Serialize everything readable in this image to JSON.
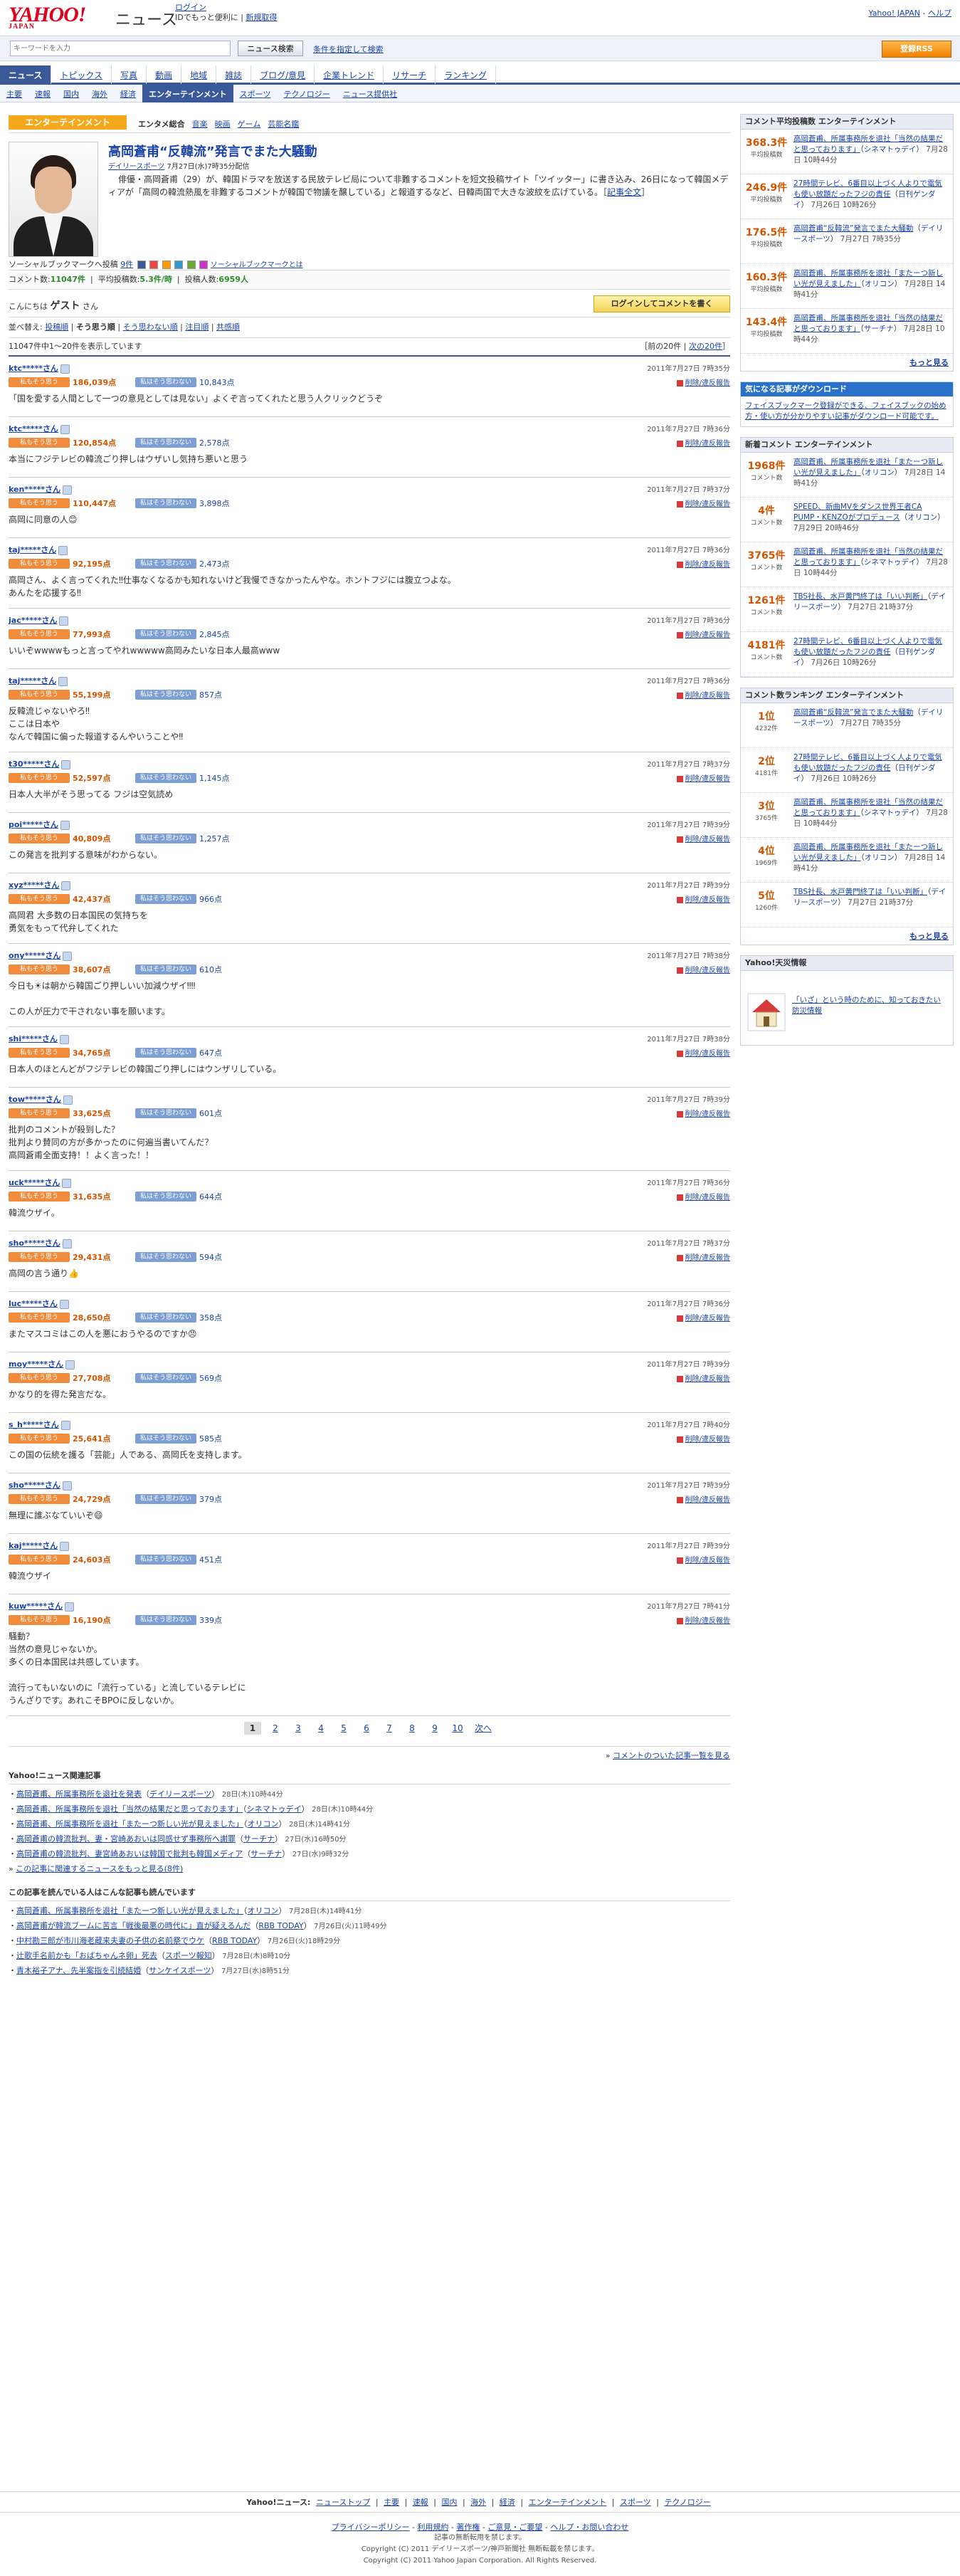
{
  "header": {
    "logo": "YAHOO!",
    "logo_sub": "JAPAN",
    "site_name": "ニュース",
    "login_link": "ログイン",
    "login_note": "IDでもっと便利に",
    "register_link": "新規取得",
    "top_links": [
      "Yahoo! JAPAN",
      "ヘルプ"
    ],
    "search_placeholder": "キーワードを入力",
    "search_button": "ニュース検索",
    "search_condition": "条件を指定して検索",
    "register_button": "登録RSS"
  },
  "global_nav": [
    "ニュース",
    "トピックス",
    "写真",
    "動画",
    "地域",
    "雑誌",
    "ブログ/意見",
    "企業トレンド",
    "リサーチ",
    "ランキング"
  ],
  "sub_nav": [
    "主要",
    "速報",
    "国内",
    "海外",
    "経済",
    "エンターテインメント",
    "スポーツ",
    "テクノロジー",
    "ニュース提供社"
  ],
  "category": {
    "label": "エンターテインメント",
    "tabs": [
      "エンタメ総合",
      "音楽",
      "映画",
      "ゲーム",
      "芸能名鑑"
    ]
  },
  "article": {
    "title": "高岡蒼甫“反韓流”発言でまた大騒動",
    "source": "デイリースポーツ",
    "date": "7月27日(水)7時35分配信",
    "body": "俳優・高岡蒼甫（29）が、韓国ドラマを放送する民放テレビ局について非難するコメントを短文投稿サイト「ツイッター」に書き込み、26日になって韓国メディアが「高岡の韓流熱風を非難するコメントが韓国で物議を醸している」と報道するなど、日韓両国で大きな波紋を広げている。",
    "full_link": "記事全文",
    "social_label": "ソーシャルブックマークへ投稿",
    "social_count": "9件",
    "social_note": "ソーシャルブックマークとは"
  },
  "stats": {
    "comment_count_label": "コメント数:",
    "comment_count": "11047件",
    "avg_label": "平均投稿数:",
    "avg": "5.3件/時",
    "posters_label": "投稿人数:",
    "posters": "6959人"
  },
  "guest": {
    "hello": "こんにちは",
    "name": "ゲスト",
    "suffix": "さん",
    "login_button": "ログインしてコメントを書く"
  },
  "sort": {
    "label": "並べ替え:",
    "options": [
      "投稿順",
      "そう思う順",
      "そう思わない順",
      "注目順",
      "共感順"
    ],
    "active": 1
  },
  "count_text": "11047件中1～20件を表示しています",
  "pager_top": [
    "前の20件",
    "次の20件"
  ],
  "vote_labels": {
    "agree": "私もそう思う",
    "disagree": "私はそう思わない",
    "report": "削除/違反報告",
    "unit": "点"
  },
  "comments": [
    {
      "user": "ktc*****さん",
      "date": "2011年7月27日 7時35分",
      "agree": "186,039",
      "disagree": "10,843",
      "lines": [
        "「国を愛する人間として一つの意見としては見ない」よくぞ言ってくれたと思う人クリックどうぞ"
      ]
    },
    {
      "user": "ktc*****さん",
      "date": "2011年7月27日 7時36分",
      "agree": "120,854",
      "disagree": "2,578",
      "lines": [
        "本当にフジテレビの韓流ごり押しはウザいし気持ち悪いと思う"
      ]
    },
    {
      "user": "ken*****さん",
      "date": "2011年7月27日 7時37分",
      "agree": "110,447",
      "disagree": "3,898",
      "lines": [
        "高岡に同意の人😊"
      ]
    },
    {
      "user": "taj*****さん",
      "date": "2011年7月27日 7時36分",
      "agree": "92,195",
      "disagree": "2,473",
      "lines": [
        "高岡さん、よく言ってくれた‼仕事なくなるかも知れないけど我慢できなかったんやな。ホントフジには腹立つよな。",
        "あんたを応援する‼"
      ]
    },
    {
      "user": "jac*****さん",
      "date": "2011年7月27日 7時36分",
      "agree": "77,993",
      "disagree": "2,845",
      "lines": [
        "いいぞwwwwもっと言ってやれwwwww高岡みたいな日本人最高www"
      ]
    },
    {
      "user": "taj*****さん",
      "date": "2011年7月27日 7時36分",
      "agree": "55,199",
      "disagree": "857",
      "lines": [
        "反韓流じゃないやろ‼",
        "ここは日本や",
        "なんで韓国に偏った報道するんやいうことや‼"
      ]
    },
    {
      "user": "t30*****さん",
      "date": "2011年7月27日 7時37分",
      "agree": "52,597",
      "disagree": "1,145",
      "lines": [
        "日本人大半がそう思ってる フジは空気読め"
      ]
    },
    {
      "user": "poi*****さん",
      "date": "2011年7月27日 7時39分",
      "agree": "40,809",
      "disagree": "1,257",
      "lines": [
        "この発言を批判する意味がわからない。"
      ]
    },
    {
      "user": "xyz*****さん",
      "date": "2011年7月27日 7時39分",
      "agree": "42,437",
      "disagree": "966",
      "lines": [
        "高岡君 大多数の日本国民の気持ちを",
        "勇気をもって代弁してくれた"
      ]
    },
    {
      "user": "ony*****さん",
      "date": "2011年7月27日 7時38分",
      "agree": "38,607",
      "disagree": "610",
      "lines": [
        "今日も☀は朝から韓国ごり押しいい加減ウザイ‼‼",
        "",
        "この人が圧力で干されない事を願います。"
      ]
    },
    {
      "user": "shi*****さん",
      "date": "2011年7月27日 7時38分",
      "agree": "34,765",
      "disagree": "647",
      "lines": [
        "日本人のほとんどがフジテレビの韓国ごり押しにはウンザリしている。"
      ]
    },
    {
      "user": "tow*****さん",
      "date": "2011年7月27日 7時39分",
      "agree": "33,625",
      "disagree": "601",
      "lines": [
        "批判のコメントが殺到した？",
        "批判より賛同の方が多かったのに何遍当書いてんだ？",
        "高岡蒼甫全面支持！！よく言った！！"
      ]
    },
    {
      "user": "uck*****さん",
      "date": "2011年7月27日 7時36分",
      "agree": "31,635",
      "disagree": "644",
      "lines": [
        "韓流ウザイ。"
      ]
    },
    {
      "user": "sho*****さん",
      "date": "2011年7月27日 7時37分",
      "agree": "29,431",
      "disagree": "594",
      "lines": [
        "高岡の言う通り👍"
      ]
    },
    {
      "user": "luc*****さん",
      "date": "2011年7月27日 7時36分",
      "agree": "28,650",
      "disagree": "358",
      "lines": [
        "またマスコミはこの人を悪におうやるのですか😠"
      ]
    },
    {
      "user": "moy*****さん",
      "date": "2011年7月27日 7時39分",
      "agree": "27,708",
      "disagree": "569",
      "lines": [
        "かなり的を得た発言だな。"
      ]
    },
    {
      "user": "s_h*****さん",
      "date": "2011年7月27日 7時40分",
      "agree": "25,641",
      "disagree": "585",
      "lines": [
        "この国の伝統を護る「芸能」人である、高岡氏を支持します。"
      ]
    },
    {
      "user": "sho*****さん",
      "date": "2011年7月27日 7時39分",
      "agree": "24,729",
      "disagree": "379",
      "lines": [
        "無理に誰ぶなていいぞ😄"
      ]
    },
    {
      "user": "kaj*****さん",
      "date": "2011年7月27日 7時39分",
      "agree": "24,603",
      "disagree": "451",
      "lines": [
        "韓流ウザイ"
      ]
    },
    {
      "user": "kuw*****さん",
      "date": "2011年7月27日 7時41分",
      "agree": "16,190",
      "disagree": "339",
      "lines": [
        "騒動？",
        "当然の意見じゃないか。",
        "多くの日本国民は共感しています。",
        "",
        "流行ってもいないのに「流行っている」と流しているテレビに",
        "うんざりです。あれこそBPOに反しないか。"
      ]
    }
  ],
  "pager": [
    "1",
    "2",
    "3",
    "4",
    "5",
    "6",
    "7",
    "8",
    "9",
    "10",
    "次へ"
  ],
  "all_comments_link": "コメントのついた記事一覧を見る",
  "related": {
    "heading": "Yahoo!ニュース関連記事",
    "items": [
      {
        "title": "高岡蒼甫、所属事務所を退社を発表",
        "src": "デイリースポーツ",
        "date": "28日(木)10時44分"
      },
      {
        "title": "高岡蒼甫、所属事務所を退社「当然の結果だと思っております」",
        "src": "シネマトゥデイ",
        "date": "28日(木)10時44分"
      },
      {
        "title": "高岡蒼甫、所属事務所を退社「またーつ新しい光が見えました」",
        "src": "オリコン",
        "date": "28日(木)14時41分"
      },
      {
        "title": "高岡蒼甫の韓流批判、妻・宮崎あおいは同感せず事務所へ謝罪",
        "src": "サーチナ",
        "date": "27日(水)16時50分"
      },
      {
        "title": "高岡蒼甫の韓流批判、妻宮崎あおいは韓国で批判も韓国メディア",
        "src": "サーチナ",
        "date": "27日(水)9時32分"
      }
    ],
    "more": "この記事に関連するニュースをもっと見る(8件)"
  },
  "also_read": {
    "heading": "この記事を読んでいる人はこんな記事も読んでいます",
    "items": [
      {
        "title": "高岡蒼甫、所属事務所を退社「またーつ新しい光が見えました」",
        "src": "オリコン",
        "date": "7月28日(木)14時41分"
      },
      {
        "title": "高岡蒼甫が韓流ブームに苦言「戦後最悪の時代に」直が疑えるんだ",
        "src": "RBB TODAY",
        "date": "7月26日(火)11時49分"
      },
      {
        "title": "中村勘三郎が市川海老蔵来夫妻の子供の名前祭でウケ",
        "src": "RBB TODAY",
        "date": "7月26日(火)18時29分"
      },
      {
        "title": "辻歌手名前かも「おばちゃんネ卵」死去",
        "src": "スポーツ報知",
        "date": "7月28日(木)8時10分"
      },
      {
        "title": "青木裕子アナ、先半案指を引続結婚",
        "src": "サンケイスポーツ",
        "date": "7月27日(水)8時51分"
      }
    ]
  },
  "footer": {
    "nav_label": "Yahoo!ニュース:",
    "nav": [
      "ニューストップ",
      "主要",
      "速報",
      "国内",
      "海外",
      "経済",
      "エンターテインメント",
      "スポーツ",
      "テクノロジー"
    ],
    "policy": [
      "プライバシーポリシー",
      "利用規約",
      "著作権",
      "ご意見・ご要望",
      "ヘルプ・お問い合わせ"
    ],
    "copy1": "記事の無断転用を禁じます。",
    "copy2": "Copyright (C) 2011 デイリースポーツ/神戸新聞社 無断転載を禁じます。",
    "copy3": "Copyright (C) 2011 Yahoo Japan Corporation. All Rights Reserved."
  },
  "side": {
    "ranking1": {
      "heading": "コメント平均投稿数",
      "category": "エンターテインメント",
      "unit": "平均投稿数",
      "items": [
        {
          "num": "368.3件",
          "title": "高岡蒼甫、所属事務所を退社「当然の結果だと思っております」",
          "src": "シネマトゥデイ",
          "date": "7月28日 10時44分"
        },
        {
          "num": "246.9件",
          "title": "27時間テレビ、6番目以上づく人よりで電気も使い放題だったフジの責任",
          "src": "日刊ゲンダイ",
          "date": "7月26日 10時26分"
        },
        {
          "num": "176.5件",
          "title": "高岡蒼甫“反韓流”発言でまた大騒動",
          "src": "デイリースポーツ",
          "date": "7月27日 7時35分"
        },
        {
          "num": "160.3件",
          "title": "高岡蒼甫、所属事務所を退社「またーつ新しい光が見えました」",
          "src": "オリコン",
          "date": "7月28日 14時41分"
        },
        {
          "num": "143.4件",
          "title": "高岡蒼甫、所属事務所を退社「当然の結果だと思っております」",
          "src": "サーチナ",
          "date": "7月28日 10時44分"
        }
      ],
      "more": "もっと見る"
    },
    "banner": {
      "heading": "気になる記事がダウンロード",
      "body": "フェイスブックマーク登録ができる、フェイスブックの始め方・使い方が分かりやすい記事がダウンロード可能です。"
    },
    "ranking2": {
      "heading": "新着コメント",
      "category": "エンターテインメント",
      "unit": "コメント数",
      "items": [
        {
          "num": "1968件",
          "title": "高岡蒼甫、所属事務所を退社「またーつ新しい光が見えました」",
          "src": "オリコン",
          "date": "7月28日 14時41分"
        },
        {
          "num": "4件",
          "title": "SPEED、新曲MVをダンス世界王者CA PUMP・KENZOがプロデュース",
          "src": "オリコン",
          "date": "7月29日 20時46分"
        },
        {
          "num": "3765件",
          "title": "高岡蒼甫、所属事務所を退社「当然の結果だと思っております」",
          "src": "シネマトゥデイ",
          "date": "7月28日 10時44分"
        },
        {
          "num": "1261件",
          "title": "TBS社長、水戸黄門終了は「いい判断」",
          "src": "デイリースポーツ",
          "date": "7月27日 21時37分"
        },
        {
          "num": "4181件",
          "title": "27時間テレビ、6番目以上づく人よりで電気も使い放題だったフジの責任",
          "src": "日刊ゲンダイ",
          "date": "7月26日 10時26分"
        }
      ]
    },
    "ranking3": {
      "heading": "コメント数ランキング",
      "category": "エンターテインメント",
      "items": [
        {
          "num": "1位",
          "sub": "4232件",
          "title": "高岡蒼甫“反韓流”発言でまた大騒動",
          "src": "デイリースポーツ",
          "date": "7月27日 7時35分"
        },
        {
          "num": "2位",
          "sub": "4181件",
          "title": "27時間テレビ、6番目以上づく人よりで電気も使い放題だったフジの責任",
          "src": "日刊ゲンダイ",
          "date": "7月26日 10時26分"
        },
        {
          "num": "3位",
          "sub": "3765件",
          "title": "高岡蒼甫、所属事務所を退社「当然の結果だと思っております」",
          "src": "シネマトゥデイ",
          "date": "7月28日 10時44分"
        },
        {
          "num": "4位",
          "sub": "1969件",
          "title": "高岡蒼甫、所属事務所を退社「またーつ新しい光が見えました」",
          "src": "オリコン",
          "date": "7月28日 14時41分"
        },
        {
          "num": "5位",
          "sub": "1260件",
          "title": "TBS社長、水戸黄門終了は「いい判断」",
          "src": "デイリースポーツ",
          "date": "7月27日 21時37分"
        }
      ],
      "more": "もっと見る"
    },
    "disaster": {
      "heading": "Yahoo!天災情報",
      "body": "「いざ」という時のために、知っておきたい防災情報"
    }
  }
}
